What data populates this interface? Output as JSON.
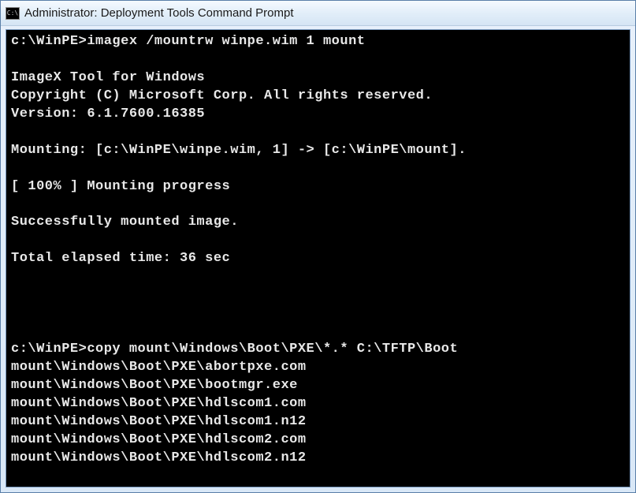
{
  "window": {
    "icon_label": "C:\\",
    "title": "Administrator: Deployment Tools Command Prompt"
  },
  "console": {
    "lines": [
      "c:\\WinPE>imagex /mountrw winpe.wim 1 mount",
      "",
      "ImageX Tool for Windows",
      "Copyright (C) Microsoft Corp. All rights reserved.",
      "Version: 6.1.7600.16385",
      "",
      "Mounting: [c:\\WinPE\\winpe.wim, 1] -> [c:\\WinPE\\mount].",
      "",
      "[ 100% ] Mounting progress",
      "",
      "Successfully mounted image.",
      "",
      "Total elapsed time: 36 sec",
      "",
      "",
      "",
      "",
      "c:\\WinPE>copy mount\\Windows\\Boot\\PXE\\*.* C:\\TFTP\\Boot",
      "mount\\Windows\\Boot\\PXE\\abortpxe.com",
      "mount\\Windows\\Boot\\PXE\\bootmgr.exe",
      "mount\\Windows\\Boot\\PXE\\hdlscom1.com",
      "mount\\Windows\\Boot\\PXE\\hdlscom1.n12",
      "mount\\Windows\\Boot\\PXE\\hdlscom2.com",
      "mount\\Windows\\Boot\\PXE\\hdlscom2.n12"
    ]
  }
}
